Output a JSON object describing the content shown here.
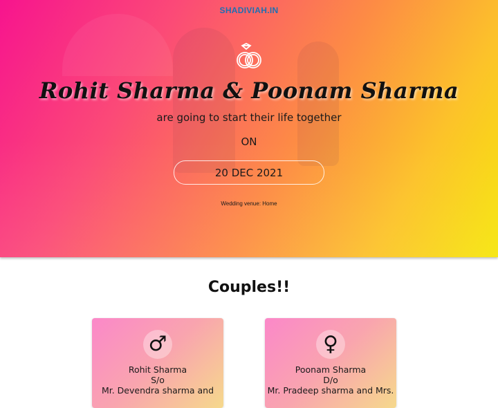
{
  "brand": "SHADIVIAH.IN",
  "hero": {
    "couple_title": "Rohit Sharma & Poonam Sharma",
    "subline": "are going to start their life together",
    "on_text": "ON",
    "date": "20 DEC 2021",
    "venue": "Wedding venue: Home",
    "icon": "wedding-rings-icon"
  },
  "couples": {
    "title": "Couples!!",
    "groom": {
      "symbol": "♂",
      "icon": "male-symbol-icon",
      "name": "Rohit Sharma",
      "relation": "S/o",
      "parents": "Mr. Devendra sharma and"
    },
    "bride": {
      "symbol": "♀",
      "icon": "female-symbol-icon",
      "name": "Poonam Sharma",
      "relation": "D/o",
      "parents": "Mr. Pradeep sharma and Mrs."
    }
  },
  "colors": {
    "hero_gradient_start": "#f7148e",
    "hero_gradient_end": "#f6e60a",
    "brand": "#1f6fb2",
    "card_gradient_start": "#fb88c9",
    "card_gradient_end": "#f6d98c"
  }
}
